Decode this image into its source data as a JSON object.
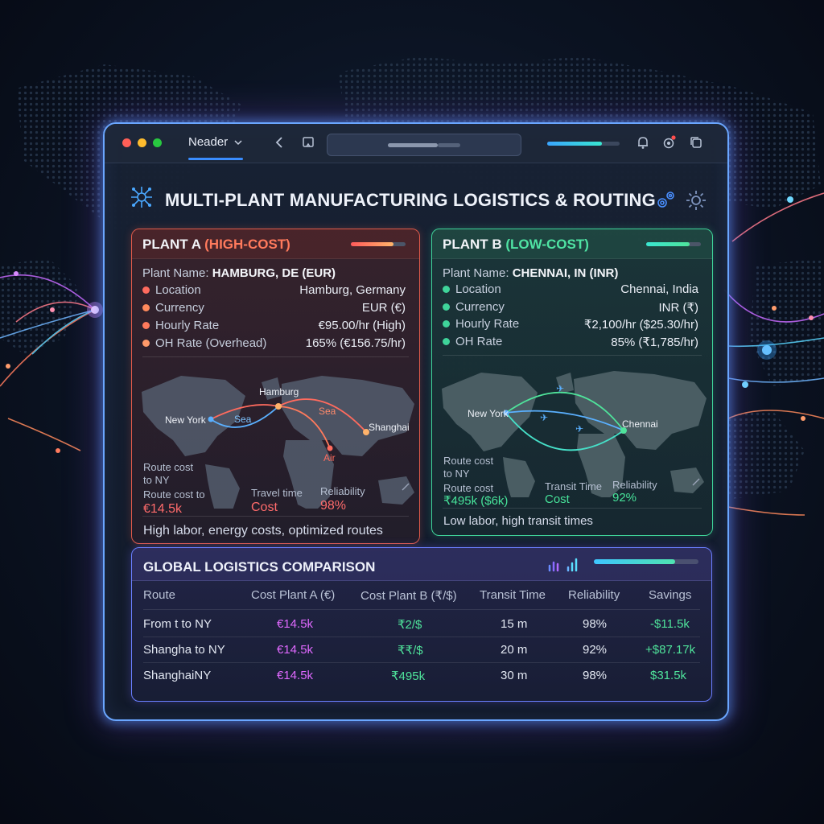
{
  "titlebar": {
    "tab_label": "Neader",
    "progress_fraction": 0.75
  },
  "dashboard": {
    "title": "MULTI-PLANT MANUFACTURING LOGISTICS & ROUTING"
  },
  "plant_a": {
    "title": "PLANT A ",
    "tag": "(HIGH-COST)",
    "name_label": "Plant Name:",
    "name_value": "HAMBURG, DE (EUR)",
    "rows": [
      {
        "label": "Location",
        "value": "Hamburg, Germany"
      },
      {
        "label": "Currency",
        "value": "EUR (€)"
      },
      {
        "label": "Hourly Rate",
        "value": "€95.00/hr (High)"
      },
      {
        "label": "OH Rate (Overhead)",
        "value": "165% (€156.75/hr)"
      }
    ],
    "map_labels": {
      "new_york": "New York",
      "hamburg": "Hamburg",
      "shanghai": "Shanghai",
      "sea1": "Sea",
      "sea2": "Sea",
      "air": "Air"
    },
    "stats": {
      "route_cost_ny": "Route cost\nto NY",
      "route_cost_to": "Route cost to",
      "route_cost_value": "€14.5k",
      "travel_time_label": "Travel time",
      "travel_time_value": "Cost",
      "reliability_label": "Reliability",
      "reliability_value": "98%"
    },
    "footer": "High labor, energy costs, optimized routes",
    "accent": "#e05a4a"
  },
  "plant_b": {
    "title": "PLANT B ",
    "tag": "(LOW-COST)",
    "name_label": "Plant Name:",
    "name_value": "CHENNAI, IN (INR)",
    "rows": [
      {
        "label": "Location",
        "value": "Chennai, India"
      },
      {
        "label": "Currency",
        "value": "INR (₹)"
      },
      {
        "label": "Hourly Rate",
        "value": "₹2,100/hr ($25.30/hr)"
      },
      {
        "label": "OH Rate",
        "value": "85% (₹1,785/hr)"
      }
    ],
    "map_labels": {
      "new_york": "New York",
      "chennai": "Chennai"
    },
    "stats": {
      "route_cost_ny": "Route cost\nto NY",
      "route_cost_label": "Route cost",
      "route_cost_value": "₹495k ($6k)",
      "transit_label": "Transit Time",
      "transit_value": "Cost",
      "reliability_label": "Reliability",
      "reliability_value": "92%"
    },
    "footer": "Low labor, high transit times",
    "accent": "#3fd49a"
  },
  "comparison": {
    "title": "GLOBAL LOGISTICS COMPARISON",
    "progress_fraction": 0.78,
    "columns": [
      "Route",
      "Cost Plant A (€)",
      "Cost Plant B (₹/$)",
      "Transit Time",
      "Reliability",
      "Savings"
    ],
    "rows": [
      [
        "From t to NY",
        "€14.5k",
        "₹2/$",
        "15 m",
        "98%",
        "-$11.5k"
      ],
      [
        "Shangha to NY",
        "€14.5k",
        "₹₹/$",
        "20 m",
        "92%",
        "+$87.17k"
      ],
      [
        "ShanghaiNY",
        "€14.5k",
        "₹495k",
        "30 m",
        "98%",
        "$31.5k"
      ]
    ]
  }
}
